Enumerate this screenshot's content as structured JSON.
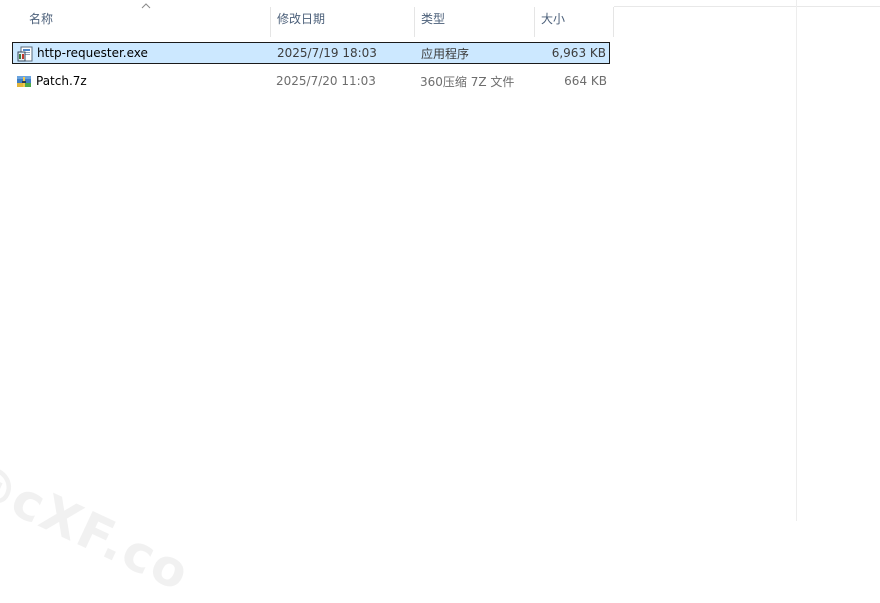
{
  "columns": {
    "name": "名称",
    "date": "修改日期",
    "type": "类型",
    "size": "大小"
  },
  "sort": {
    "column": "name",
    "direction": "ascending",
    "icon": "chevron-up-icon"
  },
  "files": [
    {
      "name": "http-requester.exe",
      "date": "2025/7/19 18:03",
      "type": "应用程序",
      "size": "6,963 KB",
      "icon": "exe-application-icon",
      "selected": true
    },
    {
      "name": "Patch.7z",
      "date": "2025/7/20 11:03",
      "type": "360压缩 7Z 文件",
      "size": "664 KB",
      "icon": "archive-7z-icon",
      "selected": false
    }
  ],
  "watermark": "@cXF.co",
  "colors": {
    "selection_bg": "#cce8ff",
    "selection_border": "#1a1a1a",
    "header_text": "#4c607a"
  }
}
